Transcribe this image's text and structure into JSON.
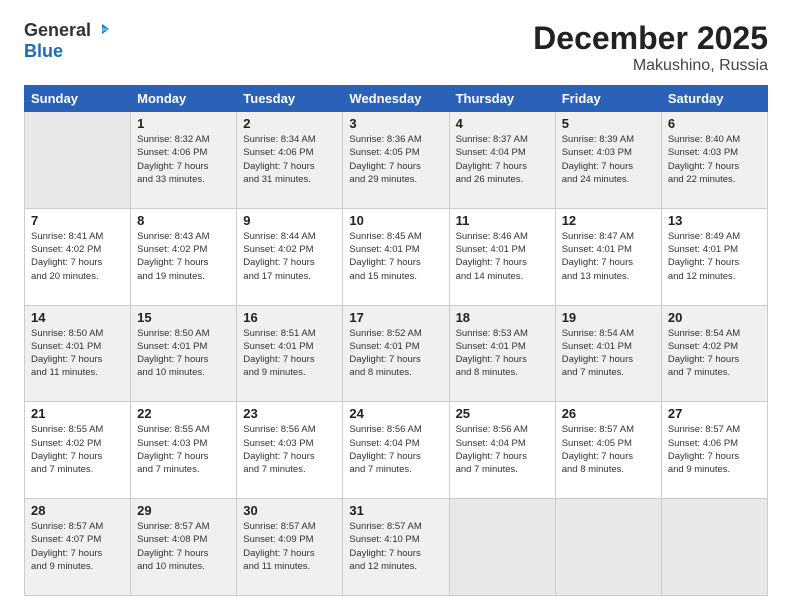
{
  "logo": {
    "general": "General",
    "blue": "Blue"
  },
  "title": {
    "month": "December 2025",
    "location": "Makushino, Russia"
  },
  "days_of_week": [
    "Sunday",
    "Monday",
    "Tuesday",
    "Wednesday",
    "Thursday",
    "Friday",
    "Saturday"
  ],
  "weeks": [
    [
      {
        "day": "",
        "info": ""
      },
      {
        "day": "1",
        "info": "Sunrise: 8:32 AM\nSunset: 4:06 PM\nDaylight: 7 hours\nand 33 minutes."
      },
      {
        "day": "2",
        "info": "Sunrise: 8:34 AM\nSunset: 4:06 PM\nDaylight: 7 hours\nand 31 minutes."
      },
      {
        "day": "3",
        "info": "Sunrise: 8:36 AM\nSunset: 4:05 PM\nDaylight: 7 hours\nand 29 minutes."
      },
      {
        "day": "4",
        "info": "Sunrise: 8:37 AM\nSunset: 4:04 PM\nDaylight: 7 hours\nand 26 minutes."
      },
      {
        "day": "5",
        "info": "Sunrise: 8:39 AM\nSunset: 4:03 PM\nDaylight: 7 hours\nand 24 minutes."
      },
      {
        "day": "6",
        "info": "Sunrise: 8:40 AM\nSunset: 4:03 PM\nDaylight: 7 hours\nand 22 minutes."
      }
    ],
    [
      {
        "day": "7",
        "info": "Sunrise: 8:41 AM\nSunset: 4:02 PM\nDaylight: 7 hours\nand 20 minutes."
      },
      {
        "day": "8",
        "info": "Sunrise: 8:43 AM\nSunset: 4:02 PM\nDaylight: 7 hours\nand 19 minutes."
      },
      {
        "day": "9",
        "info": "Sunrise: 8:44 AM\nSunset: 4:02 PM\nDaylight: 7 hours\nand 17 minutes."
      },
      {
        "day": "10",
        "info": "Sunrise: 8:45 AM\nSunset: 4:01 PM\nDaylight: 7 hours\nand 15 minutes."
      },
      {
        "day": "11",
        "info": "Sunrise: 8:46 AM\nSunset: 4:01 PM\nDaylight: 7 hours\nand 14 minutes."
      },
      {
        "day": "12",
        "info": "Sunrise: 8:47 AM\nSunset: 4:01 PM\nDaylight: 7 hours\nand 13 minutes."
      },
      {
        "day": "13",
        "info": "Sunrise: 8:49 AM\nSunset: 4:01 PM\nDaylight: 7 hours\nand 12 minutes."
      }
    ],
    [
      {
        "day": "14",
        "info": "Sunrise: 8:50 AM\nSunset: 4:01 PM\nDaylight: 7 hours\nand 11 minutes."
      },
      {
        "day": "15",
        "info": "Sunrise: 8:50 AM\nSunset: 4:01 PM\nDaylight: 7 hours\nand 10 minutes."
      },
      {
        "day": "16",
        "info": "Sunrise: 8:51 AM\nSunset: 4:01 PM\nDaylight: 7 hours\nand 9 minutes."
      },
      {
        "day": "17",
        "info": "Sunrise: 8:52 AM\nSunset: 4:01 PM\nDaylight: 7 hours\nand 8 minutes."
      },
      {
        "day": "18",
        "info": "Sunrise: 8:53 AM\nSunset: 4:01 PM\nDaylight: 7 hours\nand 8 minutes."
      },
      {
        "day": "19",
        "info": "Sunrise: 8:54 AM\nSunset: 4:01 PM\nDaylight: 7 hours\nand 7 minutes."
      },
      {
        "day": "20",
        "info": "Sunrise: 8:54 AM\nSunset: 4:02 PM\nDaylight: 7 hours\nand 7 minutes."
      }
    ],
    [
      {
        "day": "21",
        "info": "Sunrise: 8:55 AM\nSunset: 4:02 PM\nDaylight: 7 hours\nand 7 minutes."
      },
      {
        "day": "22",
        "info": "Sunrise: 8:55 AM\nSunset: 4:03 PM\nDaylight: 7 hours\nand 7 minutes."
      },
      {
        "day": "23",
        "info": "Sunrise: 8:56 AM\nSunset: 4:03 PM\nDaylight: 7 hours\nand 7 minutes."
      },
      {
        "day": "24",
        "info": "Sunrise: 8:56 AM\nSunset: 4:04 PM\nDaylight: 7 hours\nand 7 minutes."
      },
      {
        "day": "25",
        "info": "Sunrise: 8:56 AM\nSunset: 4:04 PM\nDaylight: 7 hours\nand 7 minutes."
      },
      {
        "day": "26",
        "info": "Sunrise: 8:57 AM\nSunset: 4:05 PM\nDaylight: 7 hours\nand 8 minutes."
      },
      {
        "day": "27",
        "info": "Sunrise: 8:57 AM\nSunset: 4:06 PM\nDaylight: 7 hours\nand 9 minutes."
      }
    ],
    [
      {
        "day": "28",
        "info": "Sunrise: 8:57 AM\nSunset: 4:07 PM\nDaylight: 7 hours\nand 9 minutes."
      },
      {
        "day": "29",
        "info": "Sunrise: 8:57 AM\nSunset: 4:08 PM\nDaylight: 7 hours\nand 10 minutes."
      },
      {
        "day": "30",
        "info": "Sunrise: 8:57 AM\nSunset: 4:09 PM\nDaylight: 7 hours\nand 11 minutes."
      },
      {
        "day": "31",
        "info": "Sunrise: 8:57 AM\nSunset: 4:10 PM\nDaylight: 7 hours\nand 12 minutes."
      },
      {
        "day": "",
        "info": ""
      },
      {
        "day": "",
        "info": ""
      },
      {
        "day": "",
        "info": ""
      }
    ]
  ]
}
